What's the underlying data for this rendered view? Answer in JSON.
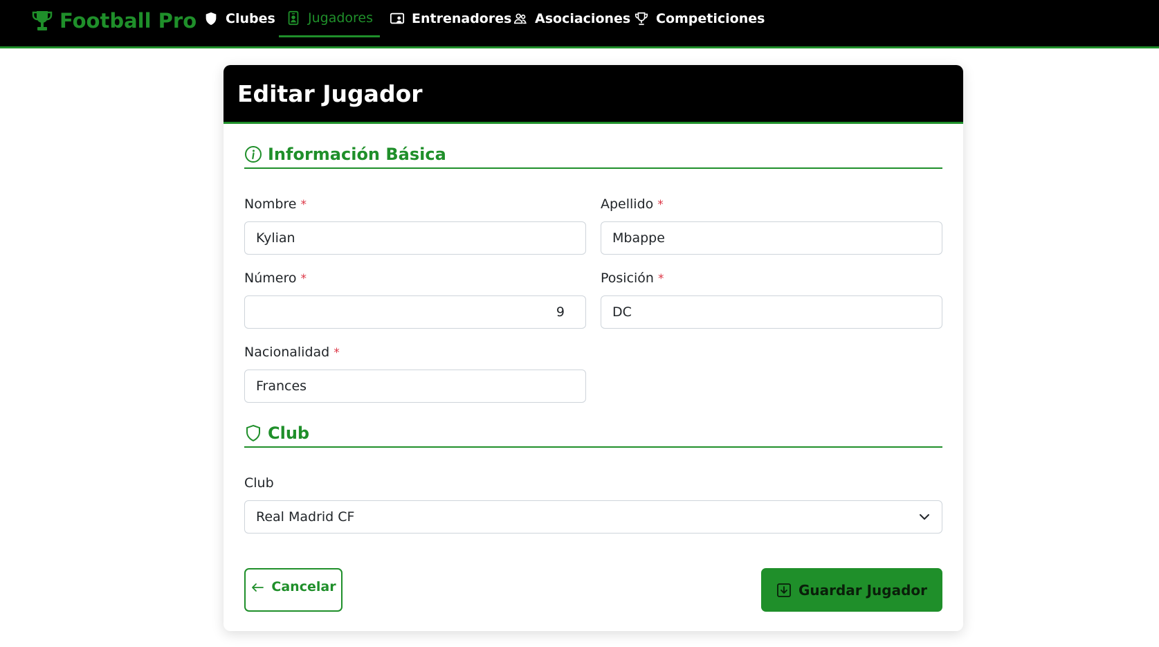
{
  "navbar": {
    "brand": "Football Pro",
    "items": [
      {
        "label": "Clubes",
        "icon": "shield-icon",
        "active": false
      },
      {
        "label": "Jugadores",
        "icon": "person-badge-icon",
        "active": true
      },
      {
        "label": "Entrenadores",
        "icon": "person-video-icon",
        "active": false
      },
      {
        "label": "Asociaciones",
        "icon": "people-icon",
        "active": false
      },
      {
        "label": "Competiciones",
        "icon": "trophy-icon",
        "active": false
      }
    ]
  },
  "page": {
    "title": "Editar Jugador"
  },
  "sections": {
    "basic": {
      "title": "Información Básica",
      "icon": "info-circle-icon"
    },
    "club": {
      "title": "Club",
      "icon": "shield-icon"
    }
  },
  "form": {
    "required_mark": "*",
    "nombre": {
      "label": "Nombre",
      "value": "Kylian"
    },
    "apellido": {
      "label": "Apellido",
      "value": "Mbappe"
    },
    "numero": {
      "label": "Número",
      "value": "9"
    },
    "posicion": {
      "label": "Posición",
      "value": "DC"
    },
    "nacionalidad": {
      "label": "Nacionalidad",
      "value": "Frances"
    },
    "club": {
      "label": "Club",
      "selected": "Real Madrid CF"
    }
  },
  "actions": {
    "cancel_label": "Cancelar",
    "save_label": "Guardar Jugador"
  },
  "colors": {
    "accent": "#1f8f2a",
    "header_bg": "#000000",
    "required": "#dc3545"
  }
}
